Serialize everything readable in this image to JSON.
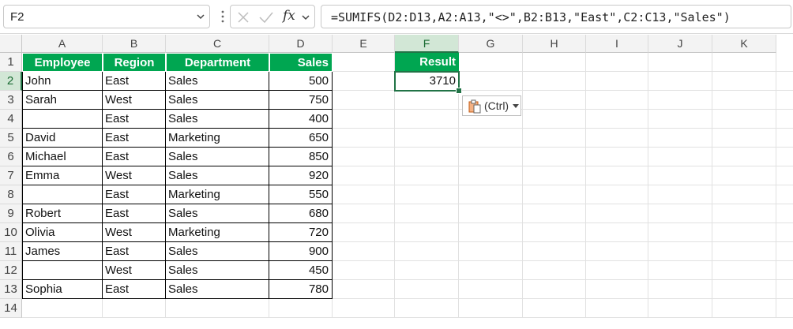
{
  "formula_bar": {
    "name_box": "F2",
    "formula": "=SUMIFS(D2:D13,A2:A13,\"<>\",B2:B13,\"East\",C2:C13,\"Sales\")",
    "fx_label": "fx"
  },
  "columns": [
    "A",
    "B",
    "C",
    "D",
    "E",
    "F",
    "G",
    "H",
    "I",
    "J",
    "K"
  ],
  "rows": [
    "1",
    "2",
    "3",
    "4",
    "5",
    "6",
    "7",
    "8",
    "9",
    "10",
    "11",
    "12",
    "13",
    "14"
  ],
  "table": {
    "headers": [
      "Employee",
      "Region",
      "Department",
      "Sales"
    ],
    "rows": [
      [
        "John",
        "East",
        "Sales",
        "500"
      ],
      [
        "Sarah",
        "West",
        "Sales",
        "750"
      ],
      [
        "",
        "East",
        "Sales",
        "400"
      ],
      [
        "David",
        "East",
        "Marketing",
        "650"
      ],
      [
        "Michael",
        "East",
        "Sales",
        "850"
      ],
      [
        "Emma",
        "West",
        "Sales",
        "920"
      ],
      [
        "",
        "East",
        "Marketing",
        "550"
      ],
      [
        "Robert",
        "East",
        "Sales",
        "680"
      ],
      [
        "Olivia",
        "West",
        "Marketing",
        "720"
      ],
      [
        "James",
        "East",
        "Sales",
        "900"
      ],
      [
        "",
        "West",
        "Sales",
        "450"
      ],
      [
        "Sophia",
        "East",
        "Sales",
        "780"
      ]
    ]
  },
  "result": {
    "header": "Result",
    "value": "3710"
  },
  "paste_options": {
    "label": "(Ctrl)"
  },
  "colors": {
    "header_green": "#00a651",
    "selection_green": "#217346"
  }
}
